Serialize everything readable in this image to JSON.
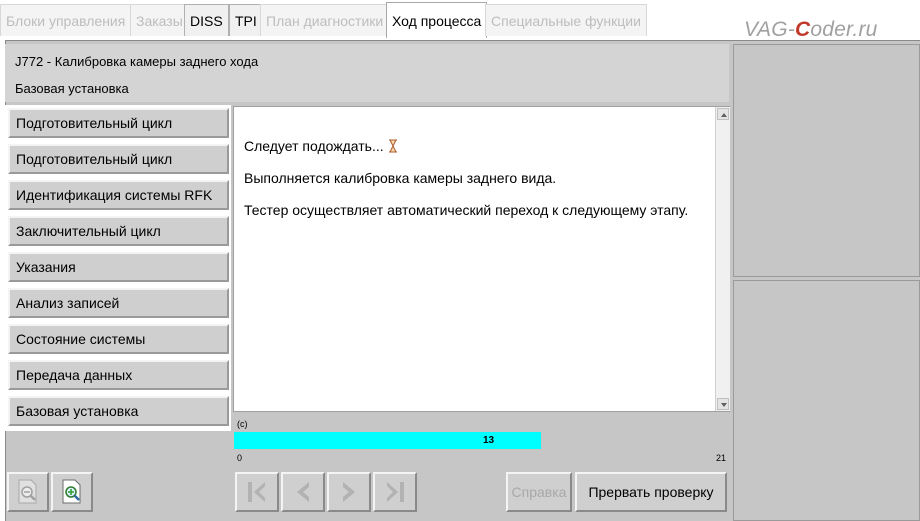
{
  "tabs": [
    {
      "label": "Блоки управления",
      "state": "disabled"
    },
    {
      "label": "Заказы",
      "state": "disabled"
    },
    {
      "label": "DISS",
      "state": "enabled"
    },
    {
      "label": "TPI",
      "state": "enabled"
    },
    {
      "label": "План диагностики",
      "state": "disabled"
    },
    {
      "label": "Ход процесса",
      "state": "active"
    },
    {
      "label": "Специальные функции",
      "state": "disabled"
    }
  ],
  "logo": {
    "prefix": "VAG-",
    "accent": "C",
    "suffix": "oder.ru",
    "accent_color": "#c0392b"
  },
  "header": {
    "title": "J772 - Калибровка камеры заднего хода",
    "subtitle": "Базовая установка"
  },
  "steps": [
    "Подготовительный цикл",
    "Подготовительный цикл",
    "Идентификация системы RFK",
    "Заключительный цикл",
    "Указания",
    "Анализ записей",
    "Состояние системы",
    "Передача данных",
    "Базовая установка"
  ],
  "content": {
    "wait_text": "Следует подождать...",
    "line2": "Выполняется калибровка камеры заднего вида.",
    "line3": "Тестер осуществляет автоматический переход к следующему этапу."
  },
  "progress": {
    "label": "(c)",
    "min": "0",
    "max": "21",
    "current": 13,
    "total": 21,
    "value_text": "13",
    "fill_color": "#00ffff"
  },
  "icons": {
    "zoom_out": "zoom-out-icon",
    "zoom_in": "zoom-in-icon",
    "first": "skip-first-icon",
    "prev": "arrow-left-icon",
    "next": "arrow-right-icon",
    "last": "skip-last-icon"
  },
  "buttons": {
    "help": "Справка",
    "abort": "Прервать проверку"
  }
}
